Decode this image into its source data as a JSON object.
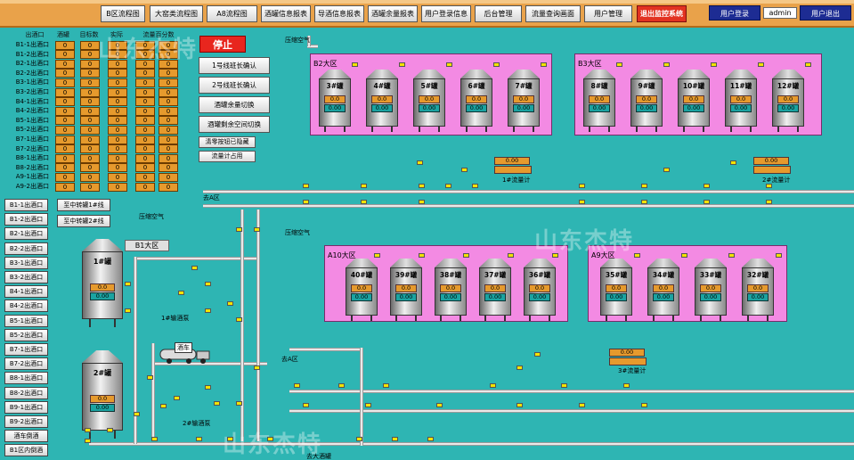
{
  "nav": {
    "buttons": [
      "B区流程图",
      "大窑类流程图",
      "A8流程图",
      "酒罐信息报表",
      "导酒信息报表",
      "酒罐余量报表",
      "用户登录信息",
      "后台管理",
      "流量查询画面",
      "用户管理",
      "退出监控系统"
    ],
    "login_label": "用户登录",
    "username": "admin",
    "logout_label": "用户退出"
  },
  "left_table": {
    "headers": [
      "出酒口",
      "酒罐",
      "目标数",
      "实际",
      "流量百分数"
    ],
    "rows": [
      "B1-1出酒口",
      "B1-2出酒口",
      "B2-1出酒口",
      "B2-2出酒口",
      "B3-1出酒口",
      "B3-2出酒口",
      "B4-1出酒口",
      "B4-2出酒口",
      "B5-1出酒口",
      "B5-2出酒口",
      "B7-1出酒口",
      "B7-2出酒口",
      "B8-1出酒口",
      "B8-2出酒口",
      "A9-1出酒口",
      "A9-2出酒口"
    ],
    "cell_value": "0"
  },
  "controls": {
    "stop": "停止",
    "line1": "1号线班长确认",
    "line2": "2号线班长确认",
    "switch_all": "酒罐余量切换",
    "switch_space": "酒罐剩余空间切换",
    "clear_hidden": "清零按钮已隐藏",
    "flow_occupied": "流量计占用"
  },
  "side_buttons": [
    "B1-1出酒口",
    "B1-2出酒口",
    "B2-1出酒口",
    "B2-2出酒口",
    "B3-1出酒口",
    "B3-2出酒口",
    "B4-1出酒口",
    "B4-2出酒口",
    "B5-1出酒口",
    "B5-2出酒口",
    "B7-1出酒口",
    "B7-2出酒口",
    "B8-1出酒口",
    "B8-2出酒口",
    "B9-1出酒口",
    "B9-2出酒口",
    "酒车倒酒",
    "B1区内倒酒"
  ],
  "transfer": [
    "至中转罐1#线",
    "至中转罐2#线"
  ],
  "zones": {
    "b2": "B2大区",
    "b3": "B3大区",
    "a10": "A10大区",
    "a9": "A9大区",
    "b1": "B1大区"
  },
  "tanks_b2": [
    "3#罐",
    "4#罐",
    "5#罐",
    "6#罐",
    "7#罐"
  ],
  "tanks_b3": [
    "8#罐",
    "9#罐",
    "10#罐",
    "11#罐",
    "12#罐"
  ],
  "tanks_a10": [
    "40#罐",
    "39#罐",
    "38#罐",
    "37#罐",
    "36#罐"
  ],
  "tanks_a9": [
    "35#罐",
    "34#罐",
    "33#罐",
    "32#罐"
  ],
  "b1_tanks": [
    "1#罐",
    "2#罐"
  ],
  "tank_value": "0.0",
  "tank_value2": "0.00",
  "labels": {
    "air1": "压缩空气",
    "air2": "压缩空气",
    "air3": "压缩空气",
    "truck": "酒车",
    "pump1": "1#输酒泵",
    "pump2": "2#输酒泵",
    "flow1": "1#流量计",
    "flow2": "2#流量计",
    "flow3": "3#流量计",
    "zoneA": "去A区",
    "zoneA2": "去A区",
    "bottom": "去大酒罐"
  },
  "flow_values": [
    "0.00",
    "0.00",
    "0.00"
  ],
  "watermark": "山东杰特"
}
